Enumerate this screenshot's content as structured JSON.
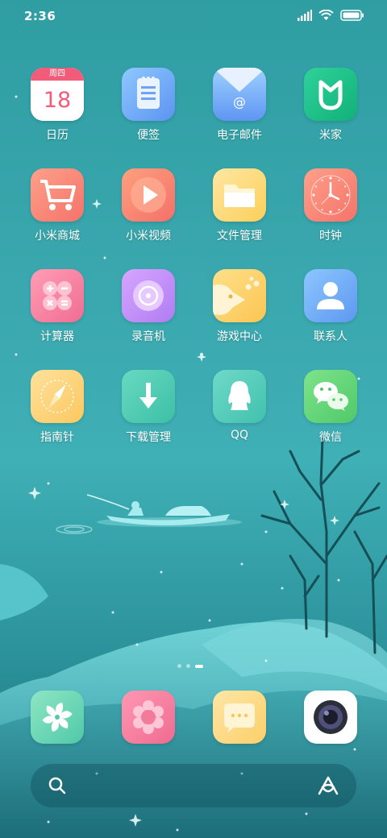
{
  "status_bar": {
    "time": "2:36"
  },
  "apps": [
    {
      "label": "日历",
      "icon": "calendar-icon",
      "weekday": "周四",
      "day": "18"
    },
    {
      "label": "便签",
      "icon": "notes-icon"
    },
    {
      "label": "电子邮件",
      "icon": "email-icon"
    },
    {
      "label": "米家",
      "icon": "mijia-icon"
    },
    {
      "label": "小米商城",
      "icon": "shopping-cart-icon"
    },
    {
      "label": "小米视频",
      "icon": "video-play-icon"
    },
    {
      "label": "文件管理",
      "icon": "folder-icon"
    },
    {
      "label": "时钟",
      "icon": "clock-icon"
    },
    {
      "label": "计算器",
      "icon": "calculator-icon"
    },
    {
      "label": "录音机",
      "icon": "recorder-icon"
    },
    {
      "label": "游戏中心",
      "icon": "game-center-icon"
    },
    {
      "label": "联系人",
      "icon": "contacts-icon"
    },
    {
      "label": "指南针",
      "icon": "compass-icon"
    },
    {
      "label": "下载管理",
      "icon": "download-icon"
    },
    {
      "label": "QQ",
      "icon": "qq-penguin-icon"
    },
    {
      "label": "微信",
      "icon": "wechat-icon"
    }
  ],
  "dock": [
    {
      "icon": "fan-pinwheel-icon"
    },
    {
      "icon": "ring-flower-icon"
    },
    {
      "icon": "message-bubble-icon"
    },
    {
      "icon": "camera-icon"
    }
  ],
  "page_indicator": {
    "count": 3,
    "active": 2
  },
  "colors": {
    "background": "#3aa8ae",
    "calendar_red": "#f25c7b"
  }
}
